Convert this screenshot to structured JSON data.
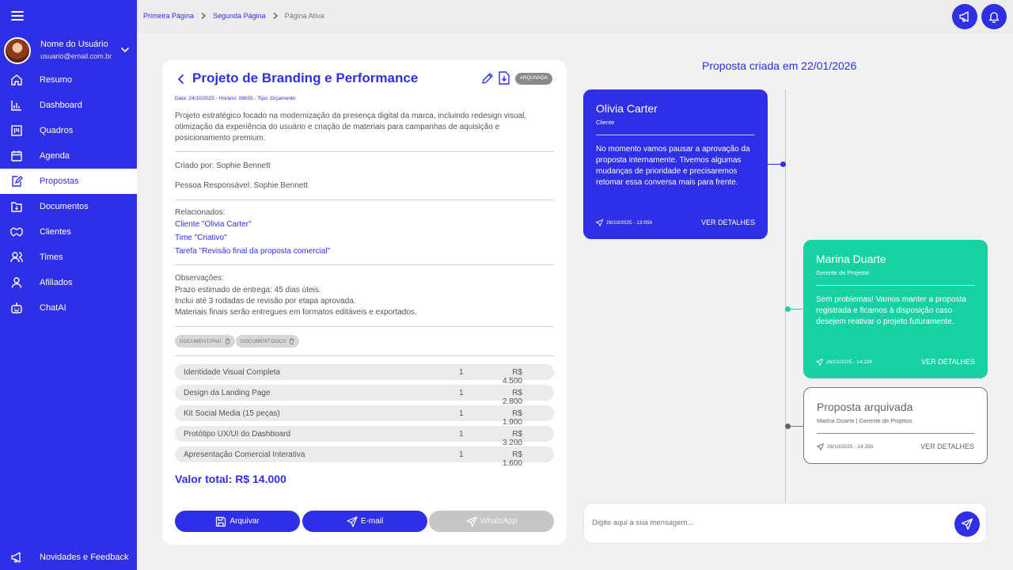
{
  "sidebar": {
    "user": {
      "name": "Nome do Usuário",
      "email": "usuario@email.com.br"
    },
    "items": [
      {
        "label": "Resumo",
        "icon": "home-icon"
      },
      {
        "label": "Dashboard",
        "icon": "bar-chart-icon"
      },
      {
        "label": "Quadros",
        "icon": "kanban-icon"
      },
      {
        "label": "Agenda",
        "icon": "calendar-icon"
      },
      {
        "label": "Propostas",
        "icon": "edit-document-icon",
        "active": true
      },
      {
        "label": "Documentos",
        "icon": "folder-icon"
      },
      {
        "label": "Clientes",
        "icon": "handshake-icon"
      },
      {
        "label": "Times",
        "icon": "users-icon"
      },
      {
        "label": "Afiliados",
        "icon": "user-icon"
      },
      {
        "label": "ChatAI",
        "icon": "robot-icon"
      }
    ],
    "bottom": {
      "label": "Novidades e Feedback",
      "icon": "megaphone-icon"
    }
  },
  "breadcrumb": [
    "Primeira Página",
    "Segunda Página",
    "Página Ativa"
  ],
  "proposal": {
    "title": "Projeto de Branding e Performance",
    "status": "ARQUIVADA",
    "meta": "Data: 24/10/2025 - Horário: 08h55 - Tipo: Orçamento",
    "description": "Projeto estratégico focado na modernização da presença digital da marca, incluindo redesign visual, otimização da experiência do usuário e criação de materiais para campanhas de aquisição e posicionamento premium.",
    "created_by_label": "Criado por:",
    "created_by": "Sophie Bennett",
    "responsible_label": "Pessoa Responsável:",
    "responsible": "Sophie Bennett",
    "related_label": "Relacionados:",
    "related": [
      "Cliente \"Olivia Carter\"",
      "Time \"Criativo\"",
      "Tarefa \"Revisão final da proposta comercial\""
    ],
    "observations_label": "Observações:",
    "observations": [
      "Prazo estimado de entrega: 45 dias úteis.",
      "Inclui até 3 rodadas de revisão por etapa aprovada.",
      "Materiais finais serão entregues em formatos editáveis e exportados."
    ],
    "attachments": [
      "DOCUMENT.PNG",
      "DOCUMENT.DOCX"
    ],
    "items": [
      {
        "name": "Identidade Visual Completa",
        "qty": "1",
        "price": "R$ 4.500"
      },
      {
        "name": "Design da Landing Page",
        "qty": "1",
        "price": "R$ 2.800"
      },
      {
        "name": "Kit Social Media (15 peças)",
        "qty": "1",
        "price": "R$ 1.900"
      },
      {
        "name": "Protótipo UX/UI do Dashboard",
        "qty": "1",
        "price": "R$ 3.200"
      },
      {
        "name": "Apresentação Comercial Interativa",
        "qty": "1",
        "price": "R$ 1.600"
      }
    ],
    "total": "Valor total: R$ 14.000",
    "actions": {
      "archive": "Arquivar",
      "email": "E-mail",
      "whatsapp": "WhatsApp"
    }
  },
  "timeline": {
    "heading": "Proposta criada em 22/01/2026",
    "entries": [
      {
        "name": "Olivia Carter",
        "role": "Cliente",
        "message": "No momento vamos pausar a aprovação da proposta internamente. Tivemos algumas mudanças de prioridade e precisaremos retomar essa conversa mais para frente.",
        "time": "26/10/2025 - 13:05h",
        "details": "VER DETALHES",
        "color": "#2f2fe8"
      },
      {
        "name": "Marina Duarte",
        "role": "Gerente de Projetos",
        "message": "Sem problemas! Vamos manter a proposta registrada e ficamos à disposição caso desejem reativar o projeto futuramente.",
        "time": "26/10/2025 - 14:22h",
        "details": "VER DETALHES",
        "color": "#17d1a3"
      },
      {
        "name": "Proposta arquivada",
        "role": "Marina Duarte | Gerente de Projetos",
        "time": "26/10/2025 - 14:25h",
        "details": "VER DETALHES",
        "color": "#777777"
      }
    ]
  },
  "message_input": {
    "placeholder": "Digite aqui a sua mensagem..."
  }
}
